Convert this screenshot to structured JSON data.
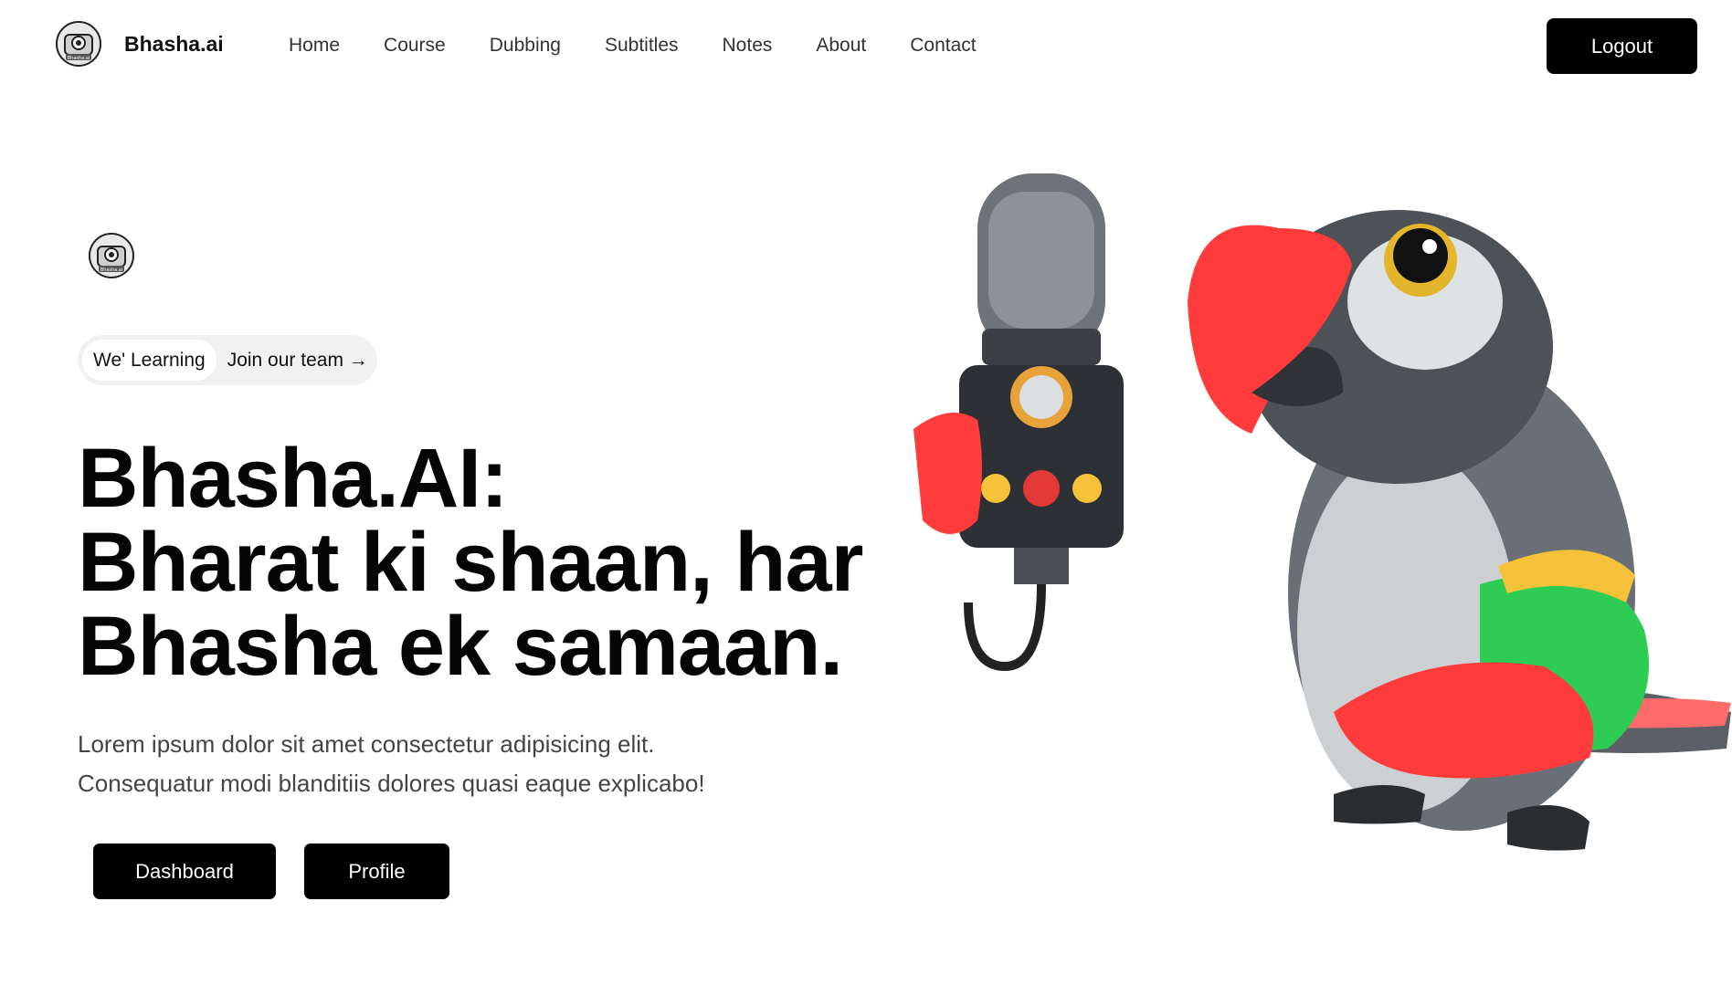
{
  "brand": {
    "name": "Bhasha.ai",
    "logo_icon": "bhasha-logo-icon",
    "logo_text": "Bhasha.ai"
  },
  "nav": {
    "items": [
      {
        "label": "Home"
      },
      {
        "label": "Course"
      },
      {
        "label": "Dubbing"
      },
      {
        "label": "Subtitles"
      },
      {
        "label": "Notes"
      },
      {
        "label": "About"
      },
      {
        "label": "Contact"
      }
    ],
    "logout_label": "Logout"
  },
  "hero": {
    "logo_icon": "bhasha-logo-icon",
    "pill": {
      "tag": "We' Learning",
      "link": "Join our team →"
    },
    "headline": {
      "line1": "Bhasha.AI:",
      "line2": "Bharat ki shaan, har",
      "line3": "Bhasha ek samaan."
    },
    "description": {
      "line1": "Lorem ipsum dolor sit amet consectetur adipisicing elit.",
      "line2": "Consequatur modi blanditiis dolores quasi eaque explicabo!"
    },
    "buttons": {
      "dashboard": "Dashboard",
      "profile": "Profile"
    },
    "illustration": "parrot-with-microphone-illustration"
  },
  "colors": {
    "button_bg": "#000000",
    "button_text": "#ffffff",
    "pill_bg": "#f1f1f1",
    "parrot_red": "#ff3b3b",
    "parrot_gray": "#5b6066",
    "parrot_green": "#2ecc52",
    "parrot_yellow": "#f5c23a"
  }
}
